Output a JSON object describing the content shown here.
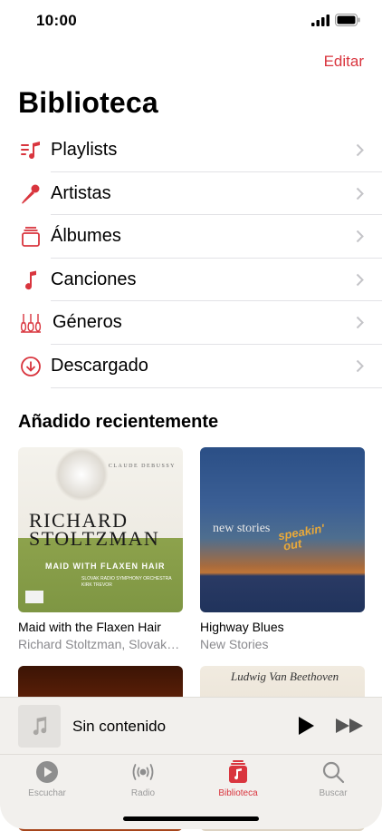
{
  "status": {
    "time": "10:00"
  },
  "header": {
    "edit_label": "Editar",
    "title": "Biblioteca"
  },
  "library_items": [
    {
      "label": "Playlists",
      "icon": "playlist-icon"
    },
    {
      "label": "Artistas",
      "icon": "microphone-icon"
    },
    {
      "label": "Álbumes",
      "icon": "album-stack-icon"
    },
    {
      "label": "Canciones",
      "icon": "music-note-icon"
    },
    {
      "label": "Géneros",
      "icon": "guitars-icon"
    },
    {
      "label": "Descargado",
      "icon": "download-circle-icon"
    }
  ],
  "recent": {
    "title": "Añadido recientemente",
    "albums": [
      {
        "title": "Maid with the Flaxen Hair",
        "artist": "Richard Stoltzman, Slovak Radio Symphony Orchestra",
        "cover": {
          "composer": "CLAUDE DEBUSSY",
          "line1": "RICHARD",
          "line2": "STOLTZMAN",
          "sub": "MAID WITH FLAXEN HAIR",
          "small1": "SLOVAK RADIO SYMPHONY ORCHESTRA",
          "small2": "KIRK TREVOR"
        }
      },
      {
        "title": "Highway Blues",
        "artist": "New Stories",
        "cover": {
          "line1": "new stories",
          "line2": "speakin'",
          "line3": "out"
        }
      },
      {
        "title": "",
        "artist": "",
        "cover": {}
      },
      {
        "title": "",
        "artist": "",
        "cover": {
          "line1": "Ludwig Van Beethoven"
        }
      }
    ]
  },
  "mini_player": {
    "title": "Sin contenido"
  },
  "tabs": [
    {
      "label": "Escuchar",
      "icon": "play-circle-icon",
      "active": false
    },
    {
      "label": "Radio",
      "icon": "radio-waves-icon",
      "active": false
    },
    {
      "label": "Biblioteca",
      "icon": "library-icon",
      "active": true
    },
    {
      "label": "Buscar",
      "icon": "search-icon",
      "active": false
    }
  ],
  "colors": {
    "accent": "#d9353e",
    "bar_background": "#f2f0ed",
    "secondary_text": "#8a8a8e"
  }
}
